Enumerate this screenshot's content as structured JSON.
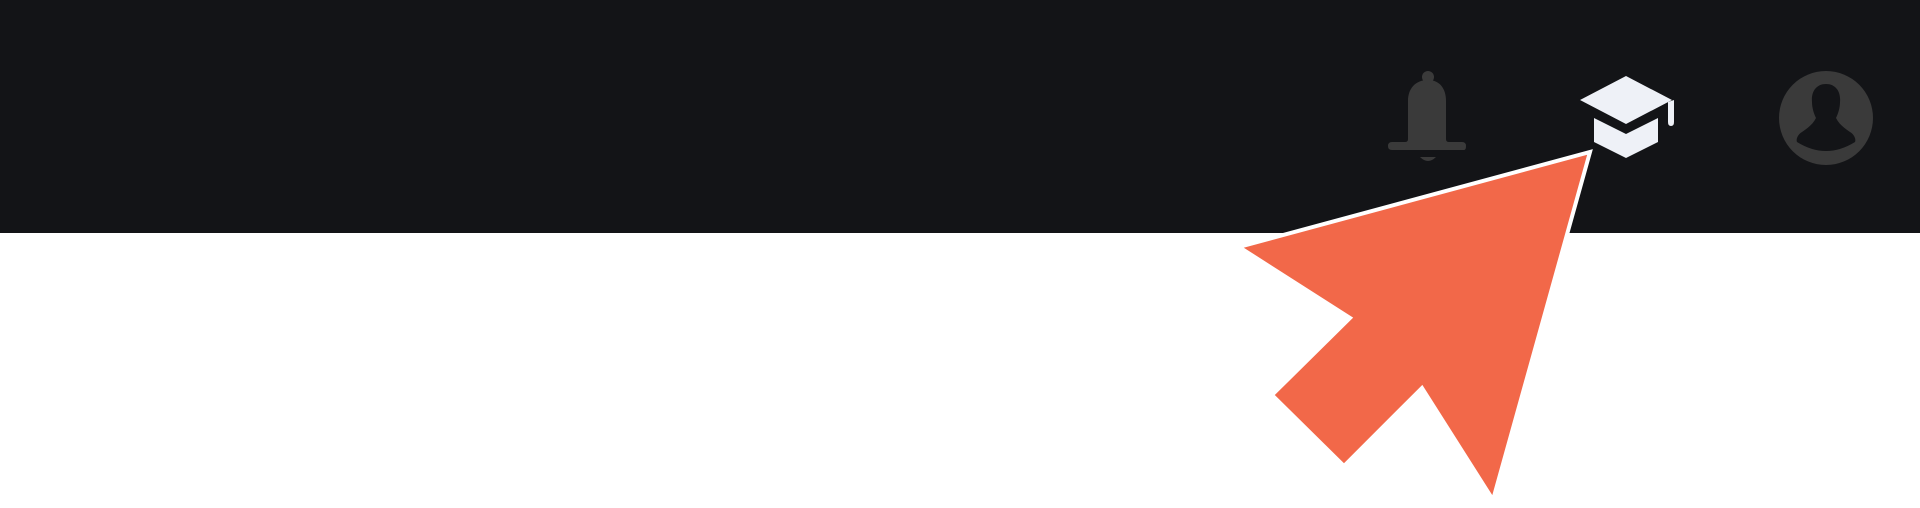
{
  "header": {
    "background_color": "#131417",
    "icons": [
      {
        "name": "notifications-bell-icon",
        "color": "#3a3a3a"
      },
      {
        "name": "learning-graduation-cap-icon",
        "color": "#eef1f7",
        "highlighted": true
      },
      {
        "name": "user-avatar-icon",
        "color": "#3a3a3a"
      }
    ]
  },
  "annotation": {
    "type": "arrow-pointer",
    "color": "#f26849",
    "outline_color": "#ffffff",
    "points_to": "learning-graduation-cap-icon"
  }
}
